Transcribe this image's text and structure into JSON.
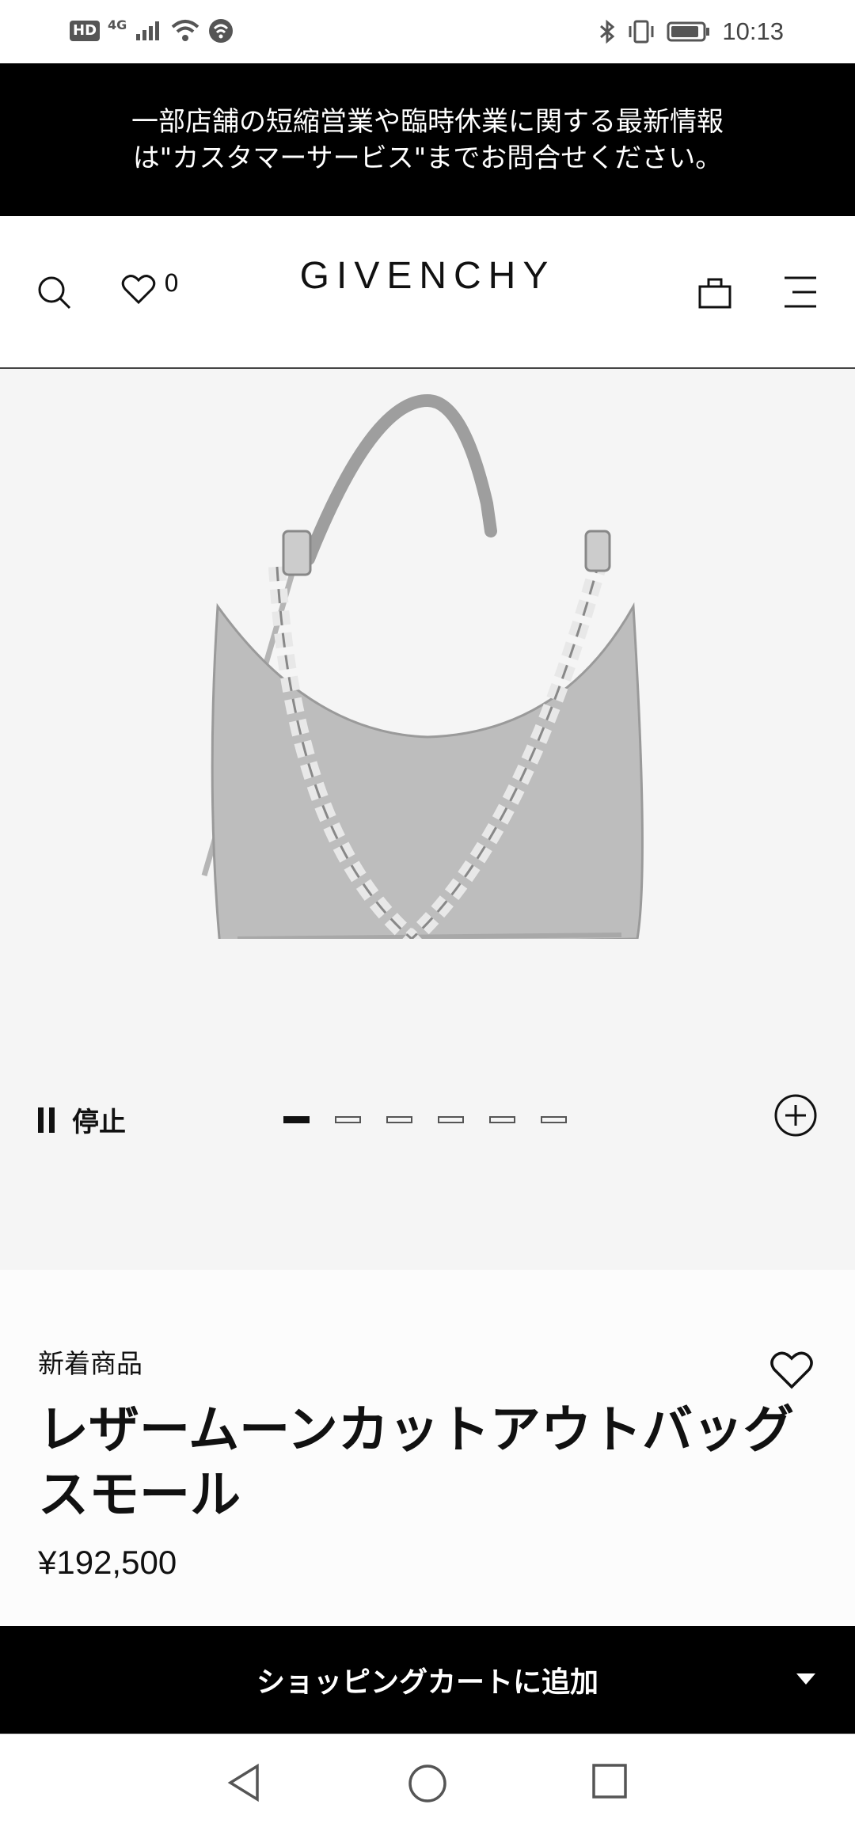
{
  "status_bar": {
    "hd": "HD",
    "network": "4G",
    "time": "10:13"
  },
  "banner": {
    "text": "一部店舗の短縮営業や臨時休業に関する最新情報\nは\"カスタマーサービス\"までお問合せください。"
  },
  "header": {
    "logo": "GIVENCHY",
    "wishlist_count": "0",
    "icons": [
      "search-icon",
      "heart-icon",
      "bag-icon",
      "menu-icon"
    ]
  },
  "gallery": {
    "pause_label": "停止",
    "slides_total": 6,
    "active_slide": 1,
    "image_alt": "leather moon cutout bag small (grey)"
  },
  "product": {
    "badge": "新着商品",
    "title": "レザームーンカットアウトバッグスモール",
    "price": "¥192,500"
  },
  "cta": {
    "label": "ショッピングカートに追加"
  },
  "colors": {
    "banner_bg": "#000000",
    "gallery_bg": "#f5f5f5",
    "bag_color": "#bdbdbd"
  }
}
